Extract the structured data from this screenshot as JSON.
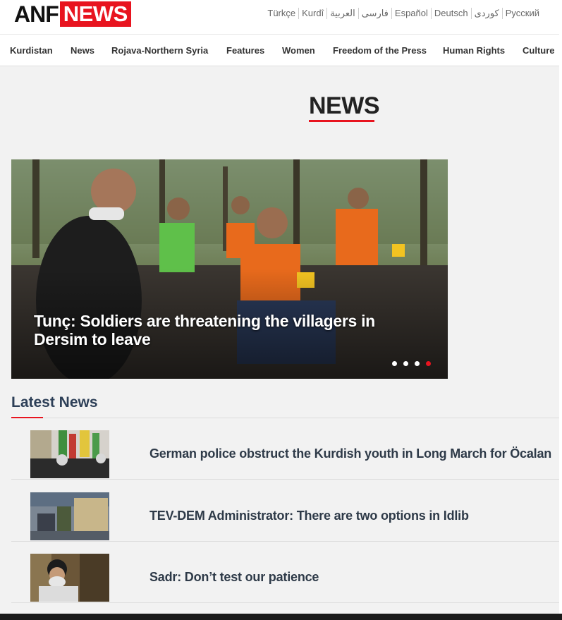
{
  "header": {
    "logo_anf": "ANF",
    "logo_news": "NEWS",
    "languages": [
      "Türkçe",
      "Kurdî",
      "العربية",
      "فارسی",
      "Español",
      "Deutsch",
      "کوردی",
      "Pусский"
    ]
  },
  "nav": {
    "items": [
      "Kurdistan",
      "News",
      "Rojava-Northern Syria",
      "Features",
      "Women",
      "Freedom of the Press",
      "Human Rights",
      "Culture"
    ]
  },
  "page": {
    "title": "NEWS"
  },
  "hero": {
    "caption": "Tunç: Soldiers are threatening the villagers in Dersim to leave",
    "slide_count": 4,
    "active_slide": 4
  },
  "latest": {
    "title": "Latest News",
    "items": [
      {
        "headline": "German police obstruct the Kurdish youth in Long March for Öcalan"
      },
      {
        "headline": "TEV-DEM Administrator: There are two options in Idlib"
      },
      {
        "headline": "Sadr: Don’t test our patience"
      }
    ]
  },
  "colors": {
    "accent": "#e8141f",
    "heading": "#2d3f57",
    "background": "#f2f2f2"
  }
}
